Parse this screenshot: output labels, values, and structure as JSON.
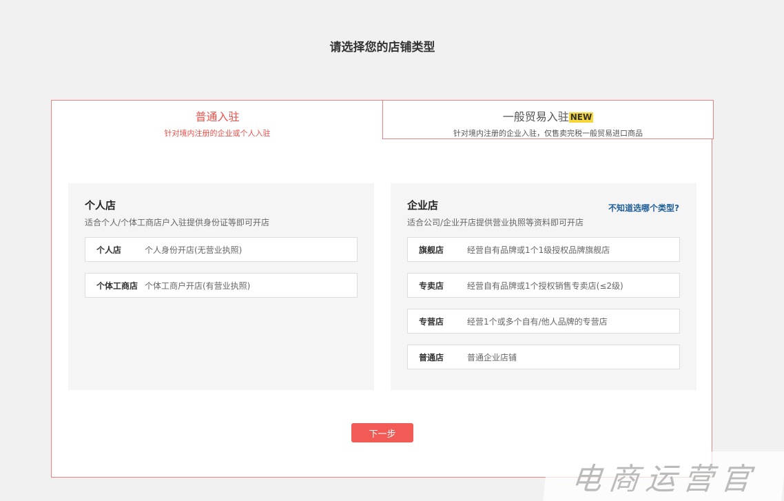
{
  "page": {
    "title": "请选择您的店铺类型"
  },
  "tabs": [
    {
      "label": "普通入驻",
      "subtitle": "针对境内注册的企业或个人入驻",
      "active": true
    },
    {
      "label": "一般贸易入驻",
      "badge": "NEW",
      "subtitle": "针对境内注册的企业入驻，仅售卖完税一般贸易进口商品",
      "active": false
    }
  ],
  "personal": {
    "title": "个人店",
    "desc": "适合个人/个体工商店户入驻提供身份证等即可开店",
    "options": [
      {
        "name": "个人店",
        "desc": "个人身份开店(无营业执照)"
      },
      {
        "name": "个体工商店",
        "desc": "个体工商户开店(有营业执照)"
      }
    ]
  },
  "enterprise": {
    "title": "企业店",
    "desc": "适合公司/企业开店提供营业执照等资料即可开店",
    "help_link": "不知道选哪个类型?",
    "options": [
      {
        "name": "旗舰店",
        "desc": "经营自有品牌或1个1级授权品牌旗舰店"
      },
      {
        "name": "专卖店",
        "desc": "经营自有品牌或1个授权销售专卖店(≤2级)"
      },
      {
        "name": "专营店",
        "desc": "经营1个或多个自有/他人品牌的专营店"
      },
      {
        "name": "普通店",
        "desc": "普通企业店铺"
      }
    ]
  },
  "actions": {
    "next_label": "下一步"
  },
  "watermark": {
    "text": "电商运营官"
  },
  "colors": {
    "accent": "#e9504a",
    "button": "#f25a55",
    "link": "#1f5e97",
    "badge": "#f5d63d"
  }
}
